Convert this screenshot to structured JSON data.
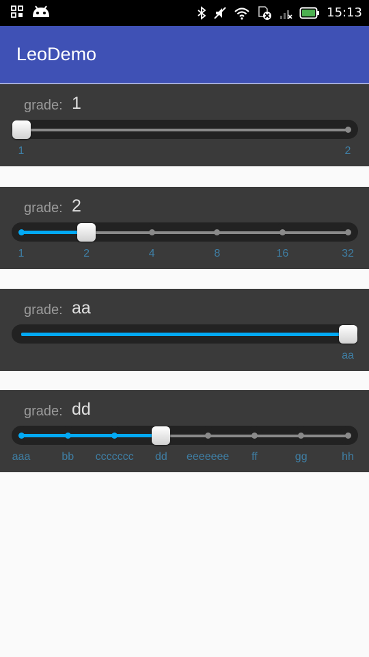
{
  "status_bar": {
    "time": "15:13",
    "icons": [
      "grid-icon",
      "android-icon",
      "bluetooth-icon",
      "mute-icon",
      "wifi-icon",
      "sim-icon",
      "signal-icon",
      "battery-icon"
    ],
    "battery_color": "#4caf50"
  },
  "app_bar": {
    "title": "LeoDemo",
    "color": "#3f51b5"
  },
  "accent_color": "#03a9f4",
  "sliders": [
    {
      "label": "grade:",
      "value": "1",
      "ticks": [
        "1",
        "2"
      ],
      "selected_index": 0
    },
    {
      "label": "grade:",
      "value": "2",
      "ticks": [
        "1",
        "2",
        "4",
        "8",
        "16",
        "32"
      ],
      "selected_index": 1
    },
    {
      "label": "grade:",
      "value": "aa",
      "ticks": [
        "aa"
      ],
      "selected_index": 0
    },
    {
      "label": "grade:",
      "value": "dd",
      "ticks": [
        "aaa",
        "bb",
        "ccccccc",
        "dd",
        "eeeeeee",
        "ff",
        "gg",
        "hh"
      ],
      "selected_index": 3
    }
  ]
}
